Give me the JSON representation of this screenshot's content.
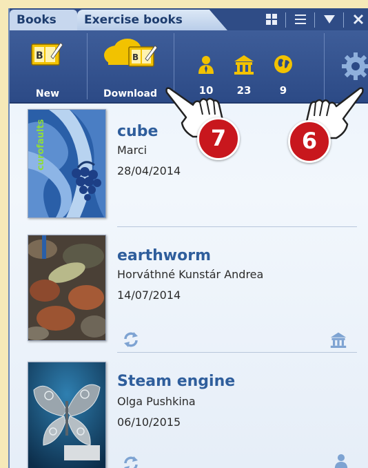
{
  "tabs": [
    {
      "label": "Books"
    },
    {
      "label": "Exercise books"
    }
  ],
  "toolbar": {
    "new_label": "New",
    "download_label": "Download",
    "stats": [
      {
        "icon": "person-icon",
        "value": "10"
      },
      {
        "icon": "school-icon",
        "value": "23"
      },
      {
        "icon": "globe-icon",
        "value": "9"
      }
    ],
    "settings_icon": "gear-icon"
  },
  "books": [
    {
      "title": "cube",
      "author": "Marci",
      "date": "28/04/2014",
      "cover_text": "curofaults"
    },
    {
      "title": "earthworm",
      "author": "Horváthné Kunstár Andrea",
      "date": "14/07/2014"
    },
    {
      "title": "Steam engine",
      "author": "Olga Pushkina",
      "date": "06/10/2015"
    }
  ],
  "callouts": [
    {
      "number": "7"
    },
    {
      "number": "6"
    }
  ],
  "colors": {
    "accent_blue": "#2f5e9c",
    "toolbar_blue": "#2c4a86",
    "badge_red": "#c8171d",
    "icon_gold": "#e8b400"
  }
}
